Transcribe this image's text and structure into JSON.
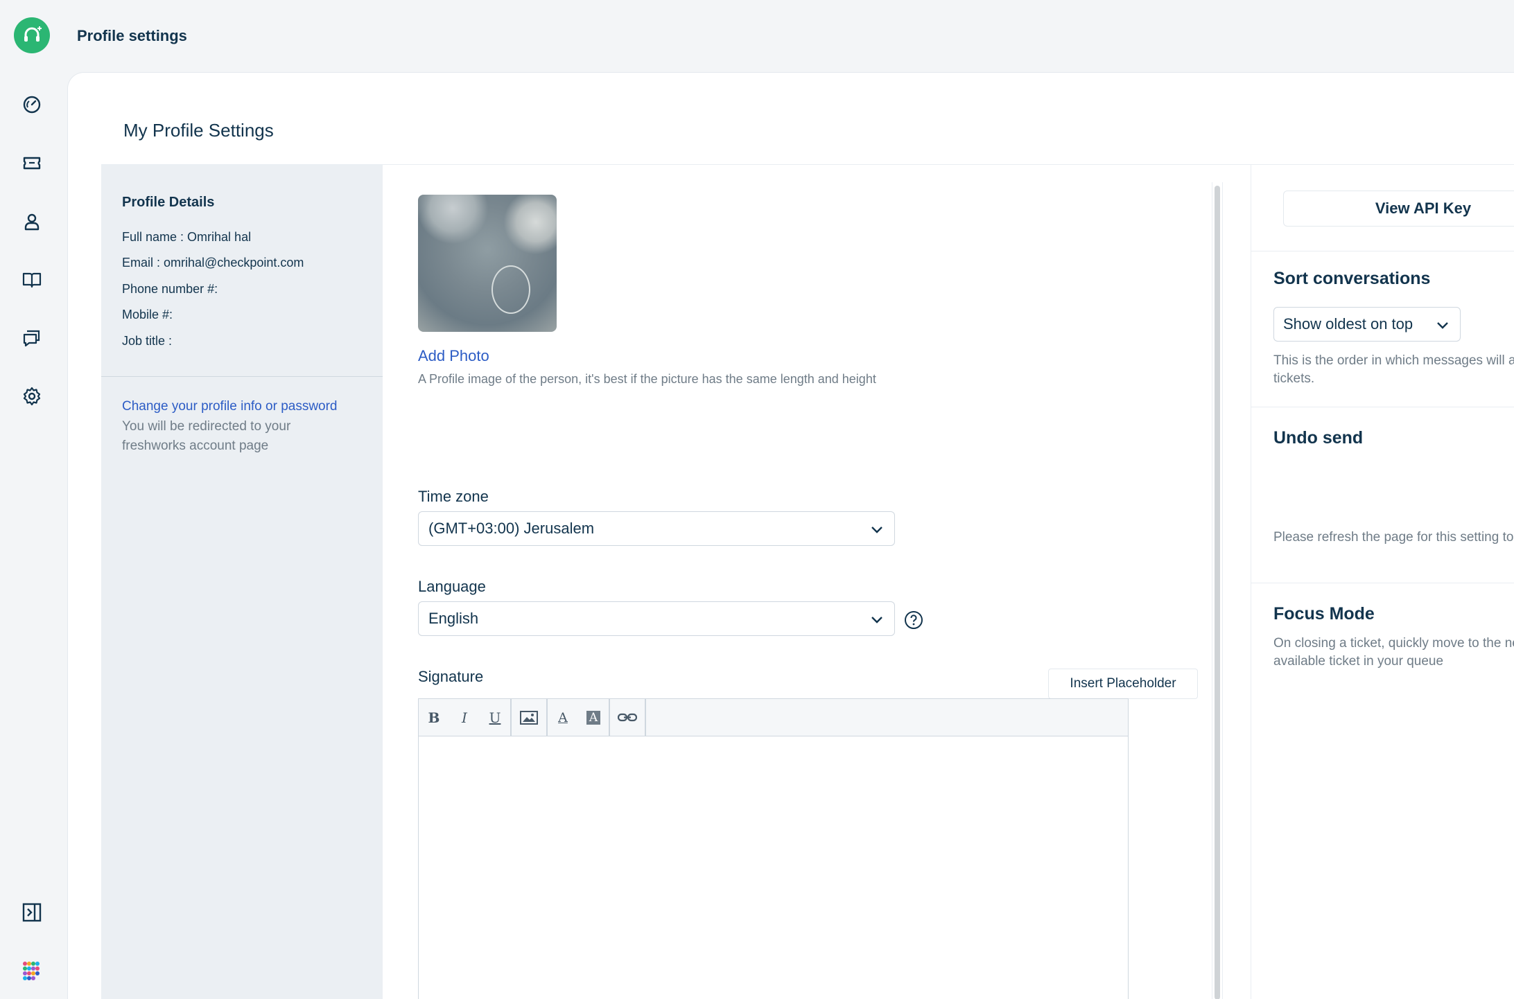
{
  "header": {
    "title": "Profile settings"
  },
  "page": {
    "title": "My Profile Settings"
  },
  "nav": {
    "items": [
      {
        "icon": "dashboard-icon"
      },
      {
        "icon": "tickets-icon"
      },
      {
        "icon": "contacts-icon"
      },
      {
        "icon": "knowledge-base-icon"
      },
      {
        "icon": "conversations-icon"
      },
      {
        "icon": "settings-icon"
      }
    ],
    "bottom": [
      {
        "icon": "expand-sidebar-icon"
      },
      {
        "icon": "apps-grid-icon"
      }
    ]
  },
  "details": {
    "title": "Profile Details",
    "full_name_label": "Full name : ",
    "full_name": "Omrihal hal",
    "email_label": "Email : ",
    "email": "omrihal@checkpoint.com",
    "phone_label": "Phone number #:",
    "mobile_label": "Mobile #:",
    "job_title_label": "Job title :",
    "change_link": "Change your profile info or password",
    "change_note": "You will be redirected to your freshworks account page"
  },
  "form": {
    "add_photo": "Add Photo",
    "photo_hint": "A Profile image of the person, it's best if the picture has the same length and height",
    "timezone_label": "Time zone",
    "timezone_value": "(GMT+03:00) Jerusalem",
    "language_label": "Language",
    "language_value": "English",
    "signature_label": "Signature",
    "insert_placeholder": "Insert Placeholder",
    "toolbar": {
      "bold": "B",
      "italic": "I",
      "underline": "U",
      "font_color": "A",
      "bg_color": "A"
    }
  },
  "settings": {
    "api_key_button": "View API Key",
    "sort_title": "Sort conversations",
    "sort_value": "Show oldest on top",
    "sort_desc": "This is the order in which messages will appear in tickets.",
    "undo_title": "Undo send",
    "undo_desc": "Please refresh the page for this setting to take effect",
    "undo_enabled": false,
    "focus_title": "Focus Mode",
    "focus_desc": "On closing a ticket, quickly move to the next available ticket in your queue",
    "focus_enabled": true
  },
  "colors": {
    "accent": "#2c5cc5",
    "brand": "#2bb673",
    "text": "#12344d",
    "muted": "#6f7c87"
  }
}
